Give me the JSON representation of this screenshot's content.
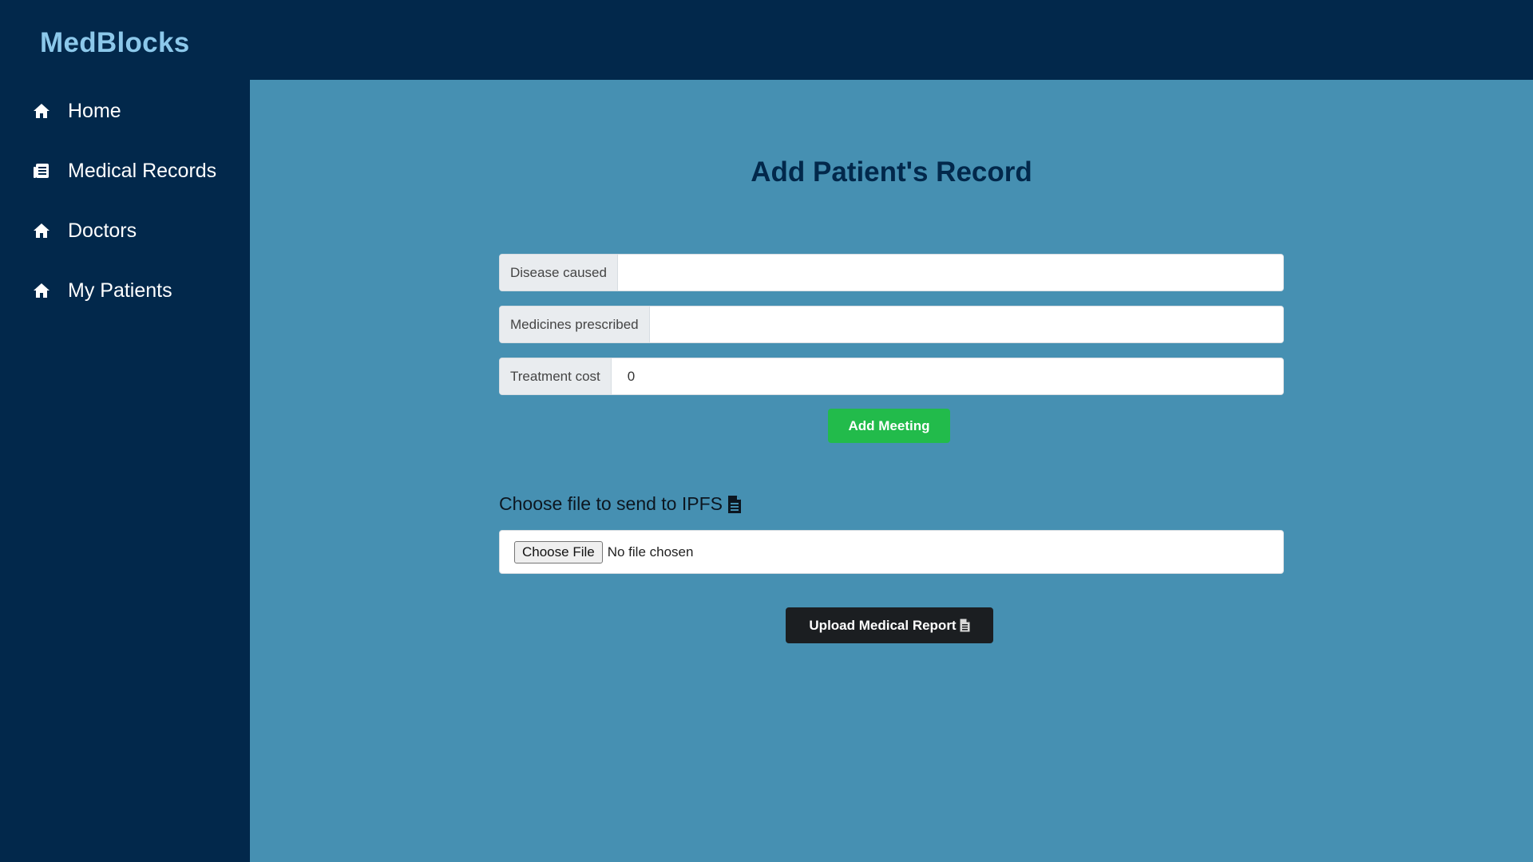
{
  "brand": "MedBlocks",
  "sidebar": {
    "items": [
      {
        "label": "Home",
        "icon": "home-icon"
      },
      {
        "label": "Medical Records",
        "icon": "records-icon"
      },
      {
        "label": "Doctors",
        "icon": "home-icon"
      },
      {
        "label": "My Patients",
        "icon": "home-icon"
      }
    ]
  },
  "main": {
    "title": "Add Patient's Record",
    "fields": {
      "disease": {
        "label": "Disease caused",
        "value": ""
      },
      "medicines": {
        "label": "Medicines prescribed",
        "value": ""
      },
      "cost": {
        "label": "Treatment cost",
        "value": "0"
      }
    },
    "add_button": "Add Meeting",
    "ipfs_label": "Choose file to send to IPFS",
    "file_input": {
      "button": "Choose File",
      "status": "No file chosen"
    },
    "upload_button": "Upload Medical Report"
  },
  "colors": {
    "sidebar_bg": "#02284b",
    "main_bg": "#4690b2",
    "brand": "#8cc8ea",
    "add_button": "#22bb4b",
    "upload_button": "#1b1e21"
  }
}
